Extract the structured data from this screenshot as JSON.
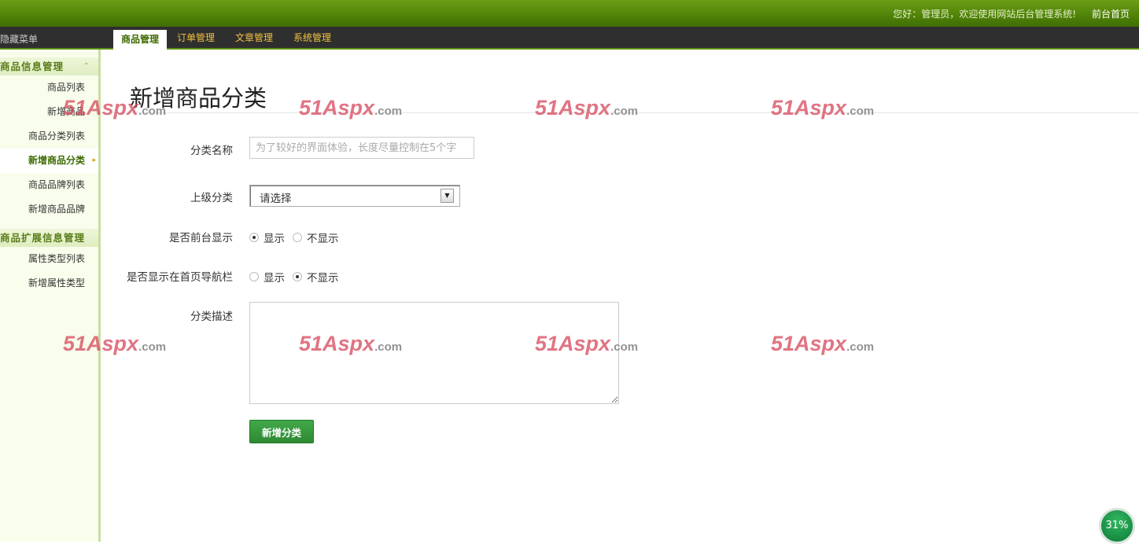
{
  "header": {
    "welcome_text": "您好：管理员，欢迎使用网站后台管理系统!",
    "home_link": "前台首页"
  },
  "menubar": {
    "hide_menu": "隐藏菜单",
    "tabs": [
      {
        "label": "商品管理",
        "active": true
      },
      {
        "label": "订单管理",
        "active": false
      },
      {
        "label": "文章管理",
        "active": false
      },
      {
        "label": "系统管理",
        "active": false
      }
    ]
  },
  "sidebar": {
    "groups": [
      {
        "title": "商品信息管理",
        "toggle": "⌃",
        "items": [
          "商品列表",
          "新增商品",
          "商品分类列表",
          "新增商品分类",
          "商品品牌列表",
          "新增商品品牌"
        ],
        "active_index": 3
      },
      {
        "title": "商品扩展信息管理",
        "items": [
          "属性类型列表",
          "新增属性类型"
        ]
      }
    ]
  },
  "main": {
    "title": "新增商品分类",
    "form": {
      "name_label": "分类名称",
      "name_placeholder": "为了较好的界面体验，长度尽量控制在5个字",
      "parent_label": "上级分类",
      "parent_value": "请选择",
      "frontend_label": "是否前台显示",
      "frontend_options": [
        "显示",
        "不显示"
      ],
      "frontend_selected": 0,
      "navbar_label": "是否显示在首页导航栏",
      "navbar_options": [
        "显示",
        "不显示"
      ],
      "navbar_selected": 1,
      "desc_label": "分类描述",
      "submit_label": "新增分类"
    }
  },
  "watermark": {
    "main": "51Aspx",
    "suffix": ".com"
  },
  "progress_badge": "31%"
}
